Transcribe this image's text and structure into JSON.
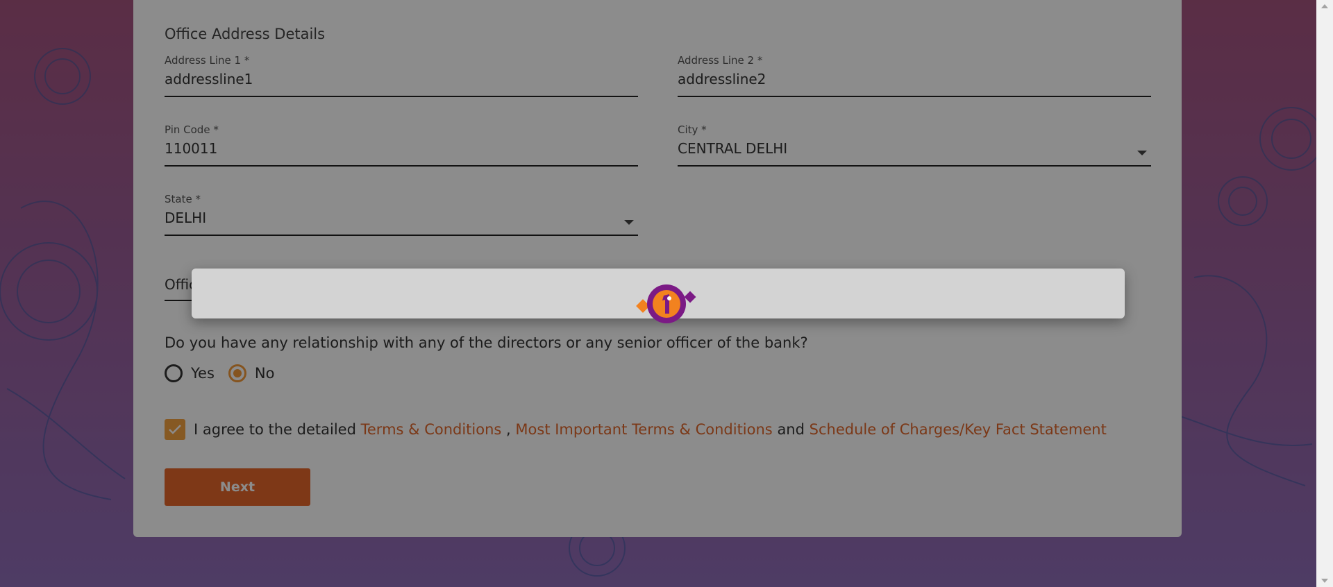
{
  "form": {
    "section_title": "Office Address Details",
    "address_line1": {
      "label": "Address Line 1 *",
      "value": "addressline1"
    },
    "address_line2": {
      "label": "Address Line 2 *",
      "value": "addressline2"
    },
    "pin_code": {
      "label": "Pin Code *",
      "value": "110011"
    },
    "city": {
      "label": "City *",
      "value": "CENTRAL DELHI"
    },
    "state": {
      "label": "State *",
      "value": "DELHI"
    },
    "partial_field_text": "Offic"
  },
  "relationship": {
    "question": "Do you have any relationship with any of the directors or any senior officer of the bank?",
    "options": [
      {
        "label": "Yes",
        "selected": false
      },
      {
        "label": "No",
        "selected": true
      }
    ]
  },
  "agreement": {
    "checked": true,
    "prefix": "I agree to the detailed",
    "link1": "Terms & Conditions",
    "sep": ",",
    "link2": "Most Important Terms & Conditions",
    "and": "and",
    "link3": "Schedule of Charges/Key Fact Statement"
  },
  "next_label": "Next",
  "colors": {
    "accent": "#e6672a",
    "radio_selected": "#f29a3a",
    "link": "#e0662a",
    "loader_purple": "#7b1a85"
  },
  "icons": {
    "loader": "bank-logo-spinner-icon",
    "dropdown": "chevron-down-icon",
    "check": "checkmark-icon"
  }
}
